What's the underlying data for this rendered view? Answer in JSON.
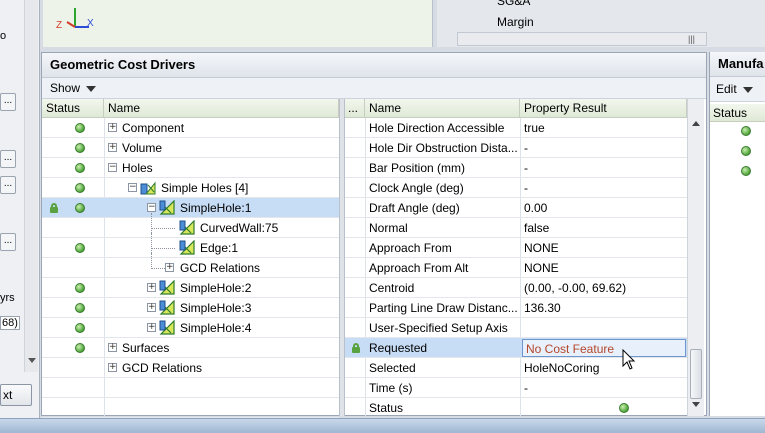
{
  "viewport": {
    "axis_labels": {
      "z": "Z",
      "x": "X"
    }
  },
  "top_right": {
    "rows": [
      "SG&A",
      "Margin"
    ]
  },
  "left_stub": {
    "texts": [
      "o",
      "yrs",
      "68)"
    ],
    "button_label": "...",
    "next_label": "xt"
  },
  "geometric_cost_drivers": {
    "title": "Geometric Cost Drivers",
    "show_label": "Show",
    "columns": {
      "status": "Status",
      "name": "Name"
    },
    "tree": [
      {
        "label": "Component",
        "status": true,
        "lock": false
      },
      {
        "label": "Volume",
        "status": true,
        "lock": false
      },
      {
        "label": "Holes",
        "status": true,
        "lock": false
      },
      {
        "label": "Simple Holes [4]",
        "status": true,
        "lock": false
      },
      {
        "label": "SimpleHole:1",
        "status": true,
        "lock": true
      },
      {
        "label": "CurvedWall:75",
        "status": false,
        "lock": false
      },
      {
        "label": "Edge:1",
        "status": true,
        "lock": false
      },
      {
        "label": "GCD Relations",
        "status": false,
        "lock": false
      },
      {
        "label": "SimpleHole:2",
        "status": true,
        "lock": false
      },
      {
        "label": "SimpleHole:3",
        "status": true,
        "lock": false
      },
      {
        "label": "SimpleHole:4",
        "status": true,
        "lock": false
      },
      {
        "label": "Surfaces",
        "status": true,
        "lock": false
      },
      {
        "label": "GCD Relations",
        "status": false,
        "lock": false
      }
    ]
  },
  "properties": {
    "columns": {
      "dots": "...",
      "name": "Name",
      "result": "Property Result"
    },
    "rows": [
      {
        "name": "Hole Direction Accessible",
        "value": "true"
      },
      {
        "name": "Hole Dir Obstruction Dista...",
        "value": "-"
      },
      {
        "name": "Bar Position (mm)",
        "value": "-"
      },
      {
        "name": "Clock Angle (deg)",
        "value": "-"
      },
      {
        "name": "Draft Angle (deg)",
        "value": "0.00"
      },
      {
        "name": "Normal",
        "value": "false"
      },
      {
        "name": "Approach From",
        "value": "NONE"
      },
      {
        "name": "Approach From Alt",
        "value": "NONE"
      },
      {
        "name": "Centroid",
        "value": "(0.00, -0.00, 69.62)"
      },
      {
        "name": "Parting Line Draw Distanc...",
        "value": "136.30"
      },
      {
        "name": "User-Specified Setup Axis",
        "value": ""
      },
      {
        "name": "Requested",
        "value": "No Cost Feature"
      },
      {
        "name": "Selected",
        "value": "HoleNoCoring"
      },
      {
        "name": "Time (s)",
        "value": "-"
      },
      {
        "name": "Status",
        "value": ""
      }
    ]
  },
  "manufacturing": {
    "title": "Manufa",
    "edit_label": "Edit",
    "status_header": "Status"
  },
  "colors": {
    "selection": "#c7dcf5",
    "status_green": "#4ea33a",
    "edit_text": "#b5462a"
  }
}
